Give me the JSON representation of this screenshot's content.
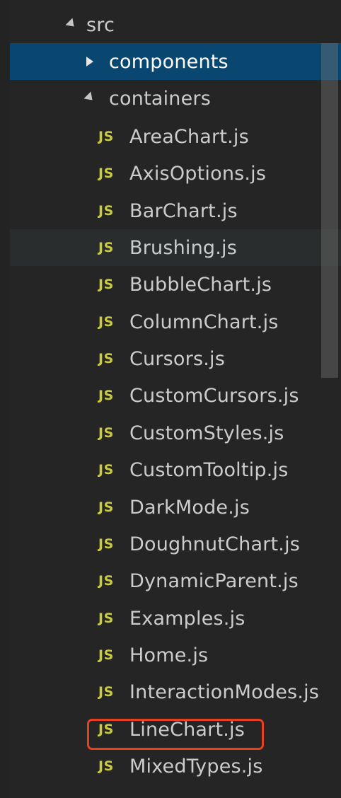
{
  "tree": {
    "root_folder": "src",
    "folders": {
      "components": "components",
      "containers": "containers"
    },
    "file_icon_label": "JS",
    "files": [
      "AreaChart.js",
      "AxisOptions.js",
      "BarChart.js",
      "Brushing.js",
      "BubbleChart.js",
      "ColumnChart.js",
      "Cursors.js",
      "CustomCursors.js",
      "CustomStyles.js",
      "CustomTooltip.js",
      "DarkMode.js",
      "DoughnutChart.js",
      "DynamicParent.js",
      "Examples.js",
      "Home.js",
      "InteractionModes.js",
      "LineChart.js",
      "MixedTypes.js"
    ]
  },
  "colors": {
    "background": "#252526",
    "selection": "#094771",
    "hover_row": "#2a2d2e",
    "js_icon": "#cbcb41",
    "text": "#cccccc",
    "highlight_annotation": "#e8401c"
  },
  "icons": {
    "expanded": "chevron-down-icon",
    "collapsed": "chevron-right-icon",
    "file": "javascript-file-icon"
  },
  "state": {
    "selected_item": "components",
    "hovered_item": "Brushing.js",
    "highlighted_item": "LineChart.js"
  }
}
